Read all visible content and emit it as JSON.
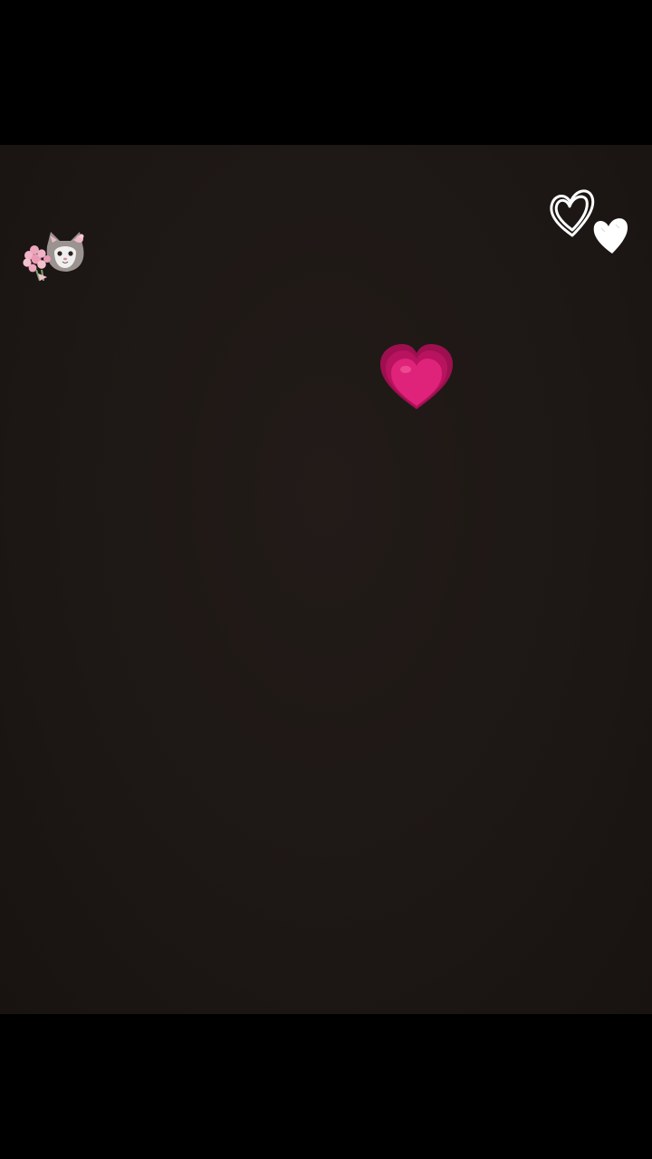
{
  "screen": {
    "background_color": "#1d1715",
    "letterbox_color": "#000000"
  },
  "stickers": [
    {
      "name": "cat-with-flowers-sticker",
      "icon": "cat-with-pink-flowers"
    },
    {
      "name": "white-doodle-hearts-sticker",
      "icon": "two-white-outline-hearts"
    },
    {
      "name": "growing-heart-sticker",
      "icon": "growing-heart",
      "color": "#e0237a"
    }
  ]
}
